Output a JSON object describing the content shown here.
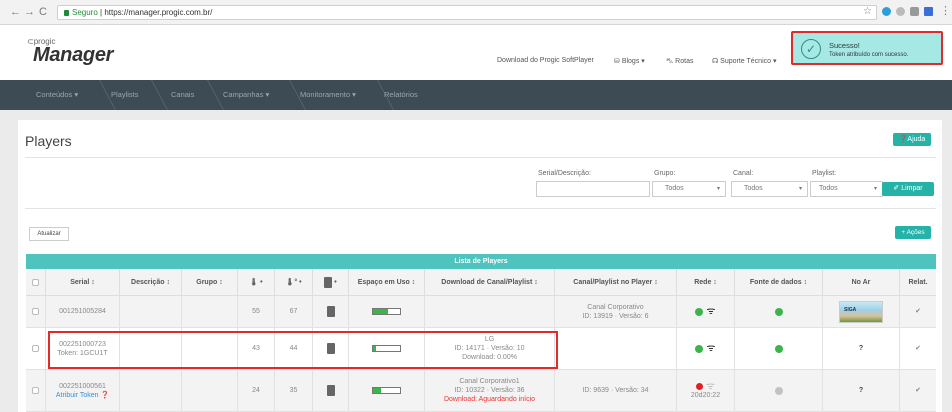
{
  "browser": {
    "security_label": "Seguro",
    "url": "https://manager.progic.com.br/"
  },
  "header": {
    "logo_small": "⊂progic",
    "logo_big": "Manager",
    "links": [
      "Download do Progic SoftPlayer",
      "Blogs",
      "Rotas",
      "Suporte Técnico"
    ]
  },
  "toast": {
    "title": "Sucesso!",
    "message": "Token atribuído com sucesso."
  },
  "menu": [
    "Conteúdos",
    "Playlists",
    "Canais",
    "Campanhas",
    "Monitoramento",
    "Relatórios"
  ],
  "page": {
    "title": "Players",
    "help_label": "Ajuda"
  },
  "filters": {
    "serial_label": "Serial/Descrição:",
    "grupo_label": "Grupo:",
    "grupo_value": "Todos",
    "canal_label": "Canal:",
    "canal_value": "Todos",
    "playlist_label": "Playlist:",
    "playlist_value": "Todos",
    "limpar_label": "Limpar"
  },
  "actions": {
    "atualizar_label": "Atualizar",
    "acoes_label": "+ Ações"
  },
  "table": {
    "title": "Lista de Players",
    "headers": [
      "Serial ↕",
      "Descrição ↕",
      "Grupo ↕",
      "",
      "",
      "",
      "Espaço em Uso ↕",
      "Download de Canal/Playlist ↕",
      "Canal/Playlist no Player ↕",
      "Rede ↕",
      "Fonte de dados ↕",
      "No Ar",
      "Relat."
    ],
    "rows": [
      {
        "serial": "001251005284",
        "serial_extra": "",
        "descricao": "",
        "grupo": "",
        "temp1": "55",
        "temp2": "67",
        "espaco_fraction": 0.55,
        "download": [
          "",
          "",
          ""
        ],
        "canal_player": [
          "Canal Corporativo",
          "ID: 13919 · Versão: 6"
        ],
        "rede_status": "wifi",
        "fonte_color": "#3bb54a",
        "no_ar": "",
        "no_ar_thumb": "SIGA",
        "relat": "✔"
      },
      {
        "serial": "002251000723",
        "serial_extra": "Token: 1GCU1T",
        "descricao": "",
        "grupo": "",
        "temp1": "43",
        "temp2": "44",
        "espaco_fraction": 0.1,
        "download": [
          "LG",
          "ID: 14171 · Versão: 10",
          "Download: 0.00%"
        ],
        "canal_player": [
          "",
          ""
        ],
        "rede_status": "wifi",
        "fonte_color": "#3bb54a",
        "no_ar": "?",
        "no_ar_thumb": "",
        "relat": "✔"
      },
      {
        "serial": "002251000561",
        "serial_extra": "Atribuir Token",
        "descricao": "",
        "grupo": "",
        "temp1": "24",
        "temp2": "35",
        "espaco_fraction": 0.3,
        "download": [
          "Canal Corporativo1",
          "ID: 10322 · Versão: 36",
          "Download: Aguardando início"
        ],
        "canal_player": [
          "ID: 9639 · Versão: 34",
          ""
        ],
        "rede_status": "offline",
        "rede_time": "20d20:22",
        "fonte_color": "#c2c2c2",
        "no_ar": "?",
        "no_ar_thumb": "",
        "relat": "✔"
      }
    ]
  }
}
